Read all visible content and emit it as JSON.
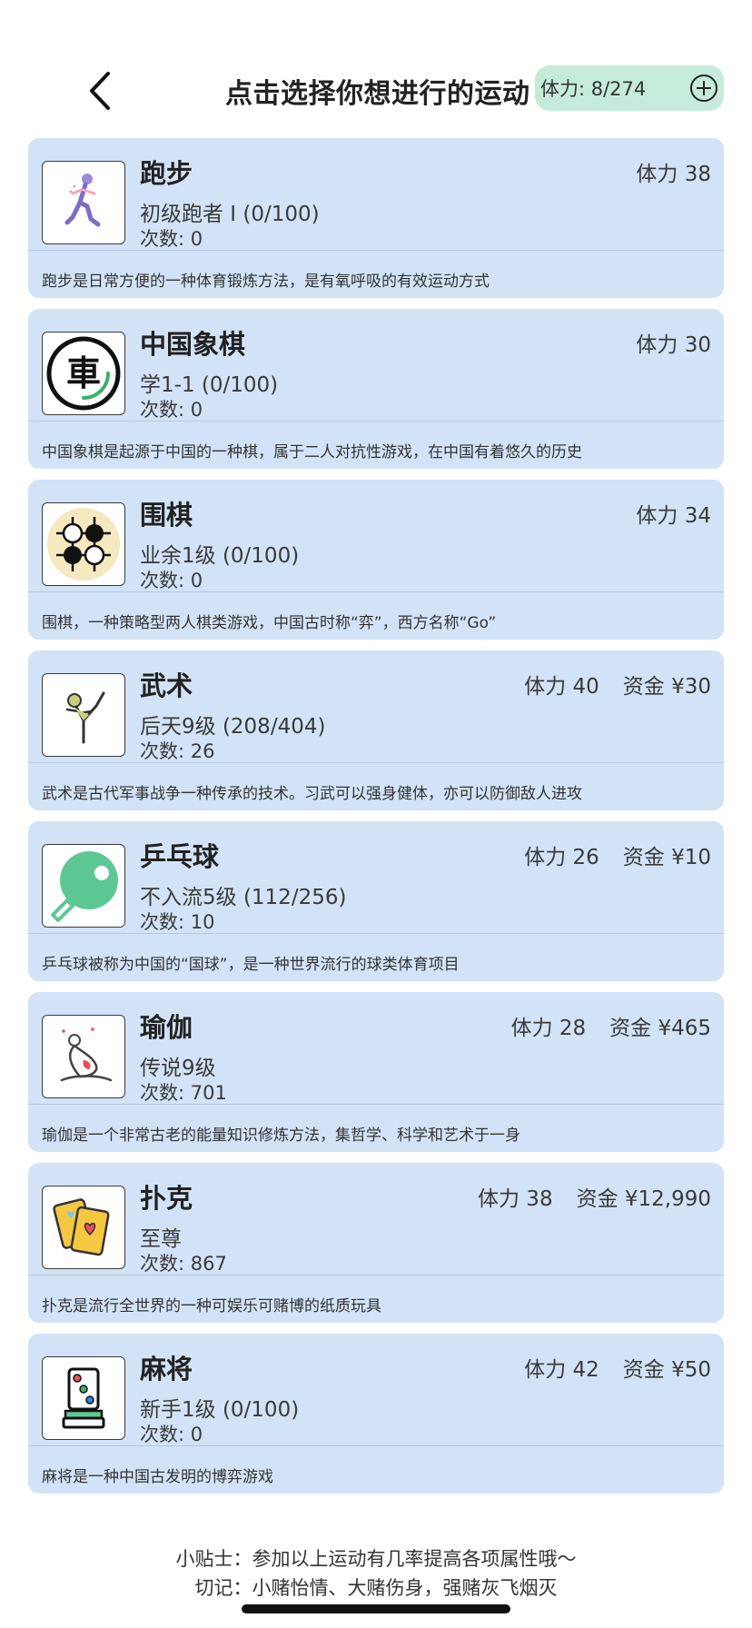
{
  "header": {
    "title": "点击选择你想进行的运动",
    "stamina": "体力: 8/274"
  },
  "activities": [
    {
      "name": "跑步",
      "level": "初级跑者 I (0/100)",
      "count": "次数: 0",
      "stamina": "体力 38",
      "funds": "",
      "desc": "跑步是日常方便的一种体育锻炼方法，是有氧呼吸的有效运动方式",
      "icon": "runner-icon"
    },
    {
      "name": "中国象棋",
      "level": "学1-1 (0/100)",
      "count": "次数: 0",
      "stamina": "体力 30",
      "funds": "",
      "desc": "中国象棋是起源于中国的一种棋，属于二人对抗性游戏，在中国有着悠久的历史",
      "icon": "xiangqi-icon",
      "icon_glyph": "車"
    },
    {
      "name": "围棋",
      "level": "业余1级 (0/100)",
      "count": "次数: 0",
      "stamina": "体力 34",
      "funds": "",
      "desc": "围棋，一种策略型两人棋类游戏，中国古时称“弈”，西方名称“Go”",
      "icon": "go-stones-icon"
    },
    {
      "name": "武术",
      "level": "后天9级 (208/404)",
      "count": "次数: 26",
      "stamina": "体力 40",
      "funds": "资金 ¥30",
      "desc": "武术是古代军事战争一种传承的技术。习武可以强身健体，亦可以防御敌人进攻",
      "icon": "martial-arts-icon"
    },
    {
      "name": "乒乓球",
      "level": "不入流5级 (112/256)",
      "count": "次数: 10",
      "stamina": "体力 26",
      "funds": "资金 ¥10",
      "desc": "乒乓球被称为中国的“国球”，是一种世界流行的球类体育项目",
      "icon": "ping-pong-icon"
    },
    {
      "name": "瑜伽",
      "level": "传说9级",
      "count": "次数: 701",
      "stamina": "体力 28",
      "funds": "资金 ¥465",
      "desc": "瑜伽是一个非常古老的能量知识修炼方法，集哲学、科学和艺术于一身",
      "icon": "yoga-icon"
    },
    {
      "name": "扑克",
      "level": "至尊",
      "count": "次数: 867",
      "stamina": "体力 38",
      "funds": "资金 ¥12,990",
      "desc": "扑克是流行全世界的一种可娱乐可赌博的纸质玩具",
      "icon": "playing-cards-icon"
    },
    {
      "name": "麻将",
      "level": "新手1级 (0/100)",
      "count": "次数: 0",
      "stamina": "体力 42",
      "funds": "资金 ¥50",
      "desc": "麻将是一种中国古发明的博弈游戏",
      "icon": "mahjong-tile-icon"
    }
  ],
  "footer": {
    "tip": "小贴士：参加以上运动有几率提高各项属性哦～",
    "warning": "切记：小赌怡情、大赌伤身，强赌灰飞烟灭"
  },
  "colors": {
    "card_bg": "#d2e3f7",
    "stamina_pill_bg": "#c5ecdb",
    "ping_pong_green": "#5dc894",
    "go_board_bg": "#f6e8bf"
  }
}
